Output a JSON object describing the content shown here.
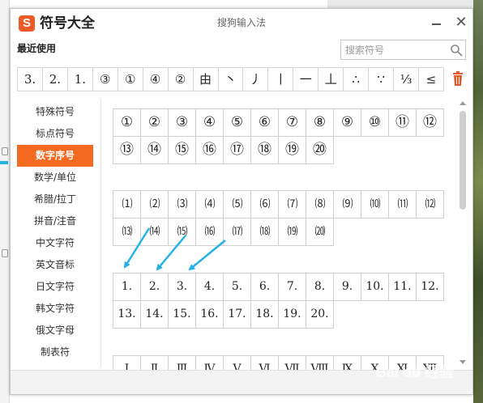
{
  "window": {
    "app_title": "符号大全",
    "window_title": "搜狗输入法",
    "logo_letter": "S"
  },
  "recent": {
    "label": "最近使用",
    "symbols": [
      "3.",
      "2.",
      "1.",
      "③",
      "①",
      "④",
      "②",
      "由",
      "丶",
      "丿",
      "丨",
      "一",
      "丄",
      "∴",
      "∵",
      "⅓",
      "≤"
    ]
  },
  "search": {
    "placeholder": "搜索符号",
    "value": ""
  },
  "sidebar": {
    "items": [
      {
        "label": "特殊符号"
      },
      {
        "label": "标点符号"
      },
      {
        "label": "数字序号",
        "active": true
      },
      {
        "label": "数学/单位"
      },
      {
        "label": "希腊/拉丁"
      },
      {
        "label": "拼音/注音"
      },
      {
        "label": "中文字符"
      },
      {
        "label": "英文音标"
      },
      {
        "label": "日文字符"
      },
      {
        "label": "韩文字符"
      },
      {
        "label": "俄文字母"
      },
      {
        "label": "制表符"
      }
    ]
  },
  "groups": {
    "circled": [
      "①",
      "②",
      "③",
      "④",
      "⑤",
      "⑥",
      "⑦",
      "⑧",
      "⑨",
      "⑩",
      "⑪",
      "⑫",
      "⑬",
      "⑭",
      "⑮",
      "⑯",
      "⑰",
      "⑱",
      "⑲",
      "⑳"
    ],
    "paren": [
      "⑴",
      "⑵",
      "⑶",
      "⑷",
      "⑸",
      "⑹",
      "⑺",
      "⑻",
      "⑼",
      "⑽",
      "⑾",
      "⑿",
      "⒀",
      "⒁",
      "⒂",
      "⒃",
      "⒄",
      "⒅",
      "⒆",
      "⒇"
    ],
    "period": [
      "1.",
      "2.",
      "3.",
      "4.",
      "5.",
      "6.",
      "7.",
      "8.",
      "9.",
      "10.",
      "11.",
      "12.",
      "13.",
      "14.",
      "15.",
      "16.",
      "17.",
      "18.",
      "19.",
      "20."
    ],
    "roman": [
      "Ⅰ",
      "Ⅱ",
      "Ⅲ",
      "Ⅳ",
      "Ⅴ",
      "Ⅵ",
      "Ⅶ",
      "Ⅷ",
      "Ⅸ",
      "Ⅹ",
      "Ⅺ",
      "Ⅻ"
    ]
  },
  "colors": {
    "accent": "#f46a21",
    "annotation_arrow": "#23b1e6"
  },
  "icons": {
    "search": "search-icon",
    "trash": "trash-icon",
    "close": "close-icon",
    "minimize": "minimize-icon"
  },
  "watermark": "Bai du 经验"
}
